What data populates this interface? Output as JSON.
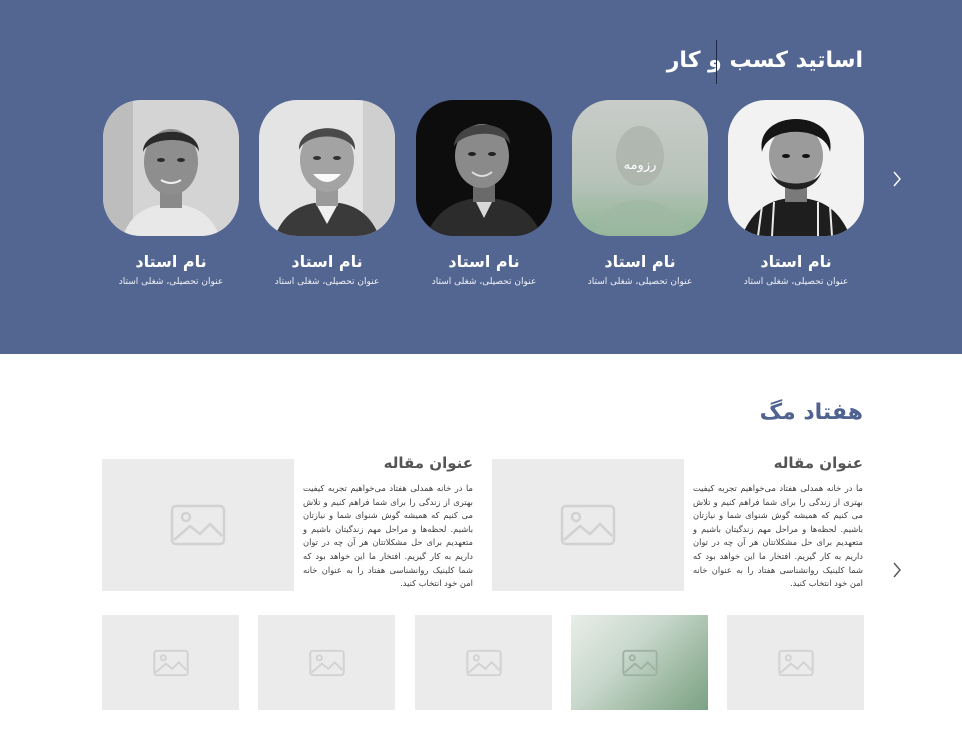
{
  "professors_section": {
    "title": "اساتید کسب و کار",
    "professors": [
      {
        "name": "نام استاد",
        "title": "عنوان تحصیلی، شغلی استاد"
      },
      {
        "name": "نام استاد",
        "title": "عنوان تحصیلی، شغلی استاد",
        "overlay": "رزومه"
      },
      {
        "name": "نام استاد",
        "title": "عنوان تحصیلی، شغلی استاد"
      },
      {
        "name": "نام استاد",
        "title": "عنوان تحصیلی، شغلی استاد"
      },
      {
        "name": "نام استاد",
        "title": "عنوان تحصیلی، شغلی استاد"
      }
    ],
    "arrow_icon": "chevron-right-icon"
  },
  "articles_section": {
    "title": "هفتاد مگ",
    "articles": [
      {
        "title": "عنوان مقاله",
        "body": "ما در خانه همدلی هفتاد می‌خواهیم تجربه کیفیت بهتری از زندگی را برای شما فراهم کنیم و تلاش می کنیم که همیشه گوش شنوای شما و نیازتان باشیم. لحظه‌ها و مراحل مهم زندگیتان باشیم و متعهدیم برای حل مشکلاتتان هر آن چه در توان داریم به کار گیریم. افتخار ما این خواهد بود که شما کلینیک روانشناسی هفتاد را به عنوان خانه امن خود انتخاب کنید."
      },
      {
        "title": "عنوان مقاله",
        "body": "ما در خانه همدلی هفتاد می‌خواهیم تجربه کیفیت بهتری از زندگی را برای شما فراهم کنیم و تلاش می کنیم که همیشه گوش شنوای شما و نیازتان باشیم. لحظه‌ها و مراحل مهم زندگیتان باشیم و متعهدیم برای حل مشکلاتتان هر آن چه در توان داریم به کار گیریم. افتخار ما این خواهد بود که شما کلینیک روانشناسی هفتاد را به عنوان خانه امن خود انتخاب کنید."
      }
    ],
    "thumbnail_count": 5,
    "image_icon": "image-placeholder-icon"
  },
  "colors": {
    "hero_bg": "#536691",
    "section_title": "#50628f",
    "placeholder_bg": "#ebebeb"
  }
}
